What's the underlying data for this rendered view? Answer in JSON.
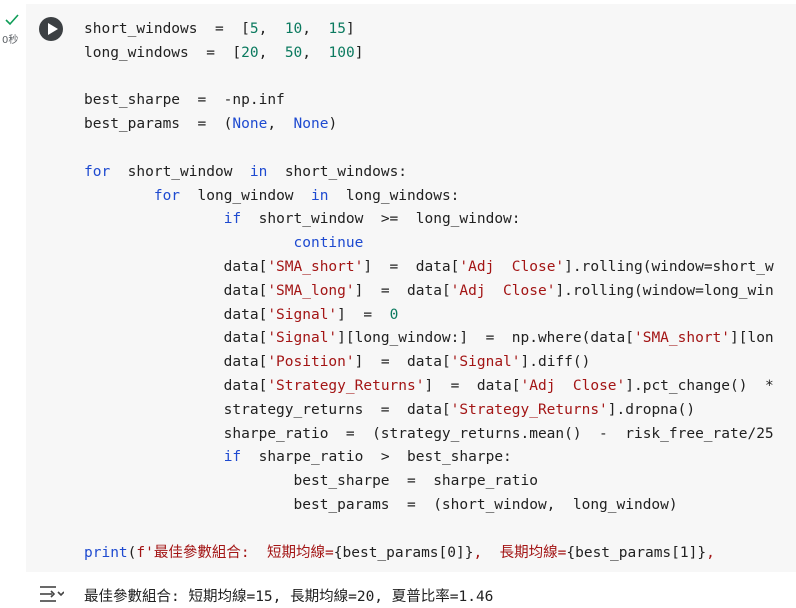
{
  "cell": {
    "exec_time": "0秒",
    "status": "success",
    "code_lines": [
      [
        {
          "t": "short_windows  =  ["
        },
        {
          "t": "5",
          "c": "num"
        },
        {
          "t": ",  "
        },
        {
          "t": "10",
          "c": "num"
        },
        {
          "t": ",  "
        },
        {
          "t": "15",
          "c": "num"
        },
        {
          "t": "]"
        }
      ],
      [
        {
          "t": "long_windows  =  ["
        },
        {
          "t": "20",
          "c": "num"
        },
        {
          "t": ",  "
        },
        {
          "t": "50",
          "c": "num"
        },
        {
          "t": ",  "
        },
        {
          "t": "100",
          "c": "num"
        },
        {
          "t": "]"
        }
      ],
      [],
      [
        {
          "t": "best_sharpe  =  -np.inf"
        }
      ],
      [
        {
          "t": "best_params  =  ("
        },
        {
          "t": "None",
          "c": "const"
        },
        {
          "t": ",  "
        },
        {
          "t": "None",
          "c": "const"
        },
        {
          "t": ")"
        }
      ],
      [],
      [
        {
          "t": "for",
          "c": "kw"
        },
        {
          "t": "  short_window  "
        },
        {
          "t": "in",
          "c": "kw"
        },
        {
          "t": "  short_windows:"
        }
      ],
      [
        {
          "t": "        "
        },
        {
          "t": "for",
          "c": "kw"
        },
        {
          "t": "  long_window  "
        },
        {
          "t": "in",
          "c": "kw"
        },
        {
          "t": "  long_windows:"
        }
      ],
      [
        {
          "t": "                "
        },
        {
          "t": "if",
          "c": "kw"
        },
        {
          "t": "  short_window  >=  long_window:"
        }
      ],
      [
        {
          "t": "                        "
        },
        {
          "t": "continue",
          "c": "kw"
        }
      ],
      [
        {
          "t": "                data["
        },
        {
          "t": "'SMA_short'",
          "c": "str"
        },
        {
          "t": "]  =  data["
        },
        {
          "t": "'Adj  Close'",
          "c": "str"
        },
        {
          "t": "].rolling(window=short_w"
        }
      ],
      [
        {
          "t": "                data["
        },
        {
          "t": "'SMA_long'",
          "c": "str"
        },
        {
          "t": "]  =  data["
        },
        {
          "t": "'Adj  Close'",
          "c": "str"
        },
        {
          "t": "].rolling(window=long_win"
        }
      ],
      [
        {
          "t": "                data["
        },
        {
          "t": "'Signal'",
          "c": "str"
        },
        {
          "t": "]  =  "
        },
        {
          "t": "0",
          "c": "num"
        }
      ],
      [
        {
          "t": "                data["
        },
        {
          "t": "'Signal'",
          "c": "str"
        },
        {
          "t": "][long_window:]  =  np.where(data["
        },
        {
          "t": "'SMA_short'",
          "c": "str"
        },
        {
          "t": "][lon"
        }
      ],
      [
        {
          "t": "                data["
        },
        {
          "t": "'Position'",
          "c": "str"
        },
        {
          "t": "]  =  data["
        },
        {
          "t": "'Signal'",
          "c": "str"
        },
        {
          "t": "].diff()"
        }
      ],
      [
        {
          "t": "                data["
        },
        {
          "t": "'Strategy_Returns'",
          "c": "str"
        },
        {
          "t": "]  =  data["
        },
        {
          "t": "'Adj  Close'",
          "c": "str"
        },
        {
          "t": "].pct_change()  *"
        }
      ],
      [
        {
          "t": "                strategy_returns  =  data["
        },
        {
          "t": "'Strategy_Returns'",
          "c": "str"
        },
        {
          "t": "].dropna()"
        }
      ],
      [
        {
          "t": "                sharpe_ratio  =  (strategy_returns.mean()  -  risk_free_rate/25"
        }
      ],
      [
        {
          "t": "                "
        },
        {
          "t": "if",
          "c": "kw"
        },
        {
          "t": "  sharpe_ratio  >  best_sharpe:"
        }
      ],
      [
        {
          "t": "                        best_sharpe  =  sharpe_ratio"
        }
      ],
      [
        {
          "t": "                        best_params  =  (short_window,  long_window)"
        }
      ],
      [],
      [
        {
          "t": "print",
          "c": "kw"
        },
        {
          "t": "("
        },
        {
          "t": "f'最佳參數組合:  短期均線=",
          "c": "str"
        },
        {
          "t": "{best_params[0]}"
        },
        {
          "t": ",  長期均線=",
          "c": "str"
        },
        {
          "t": "{best_params[1]}"
        },
        {
          "t": ",  ",
          "c": "str"
        }
      ]
    ]
  },
  "output": {
    "text": "最佳參數組合: 短期均線=15, 長期均線=20, 夏普比率=1.46"
  },
  "colors": {
    "keyword": "#1e4ad0",
    "string": "#a31515",
    "number": "#0b7a5f",
    "success": "#0f9d58",
    "cell_bg": "#f7f7f7"
  },
  "icons": {
    "run": "play-icon",
    "status": "check-icon",
    "output": "output-toggle-icon"
  }
}
